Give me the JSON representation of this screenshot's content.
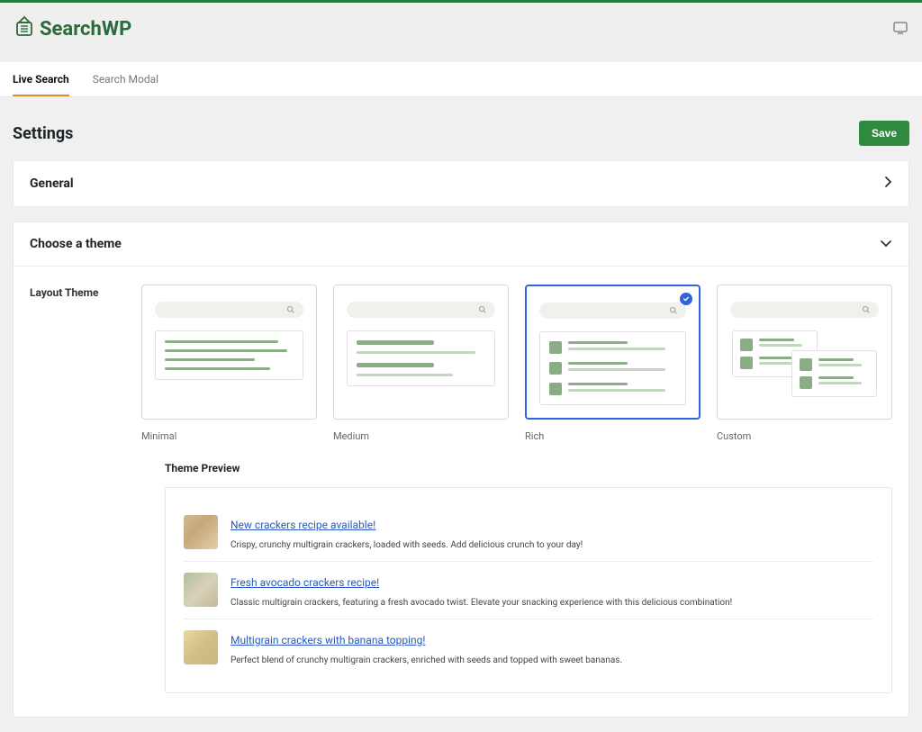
{
  "brand": {
    "name": "SearchWP"
  },
  "tabs": [
    {
      "label": "Live Search",
      "active": true
    },
    {
      "label": "Search Modal",
      "active": false
    }
  ],
  "page": {
    "title": "Settings",
    "save_label": "Save"
  },
  "sections": {
    "general": {
      "title": "General"
    },
    "theme": {
      "title": "Choose a theme",
      "layout_label": "Layout Theme",
      "preview_label": "Theme Preview",
      "options": [
        {
          "name": "Minimal"
        },
        {
          "name": "Medium"
        },
        {
          "name": "Rich"
        },
        {
          "name": "Custom"
        }
      ],
      "selected_index": 2,
      "preview_items": [
        {
          "title": "New crackers recipe available!",
          "desc": "Crispy, crunchy multigrain crackers, loaded with seeds. Add delicious crunch to your day!"
        },
        {
          "title": "Fresh avocado crackers recipe!",
          "desc": "Classic multigrain crackers, featuring a fresh avocado twist. Elevate your snacking experience with this delicious combination!"
        },
        {
          "title": "Multigrain crackers with banana topping!",
          "desc": "Perfect blend of crunchy multigrain crackers, enriched with seeds and topped with sweet bananas."
        }
      ]
    }
  }
}
